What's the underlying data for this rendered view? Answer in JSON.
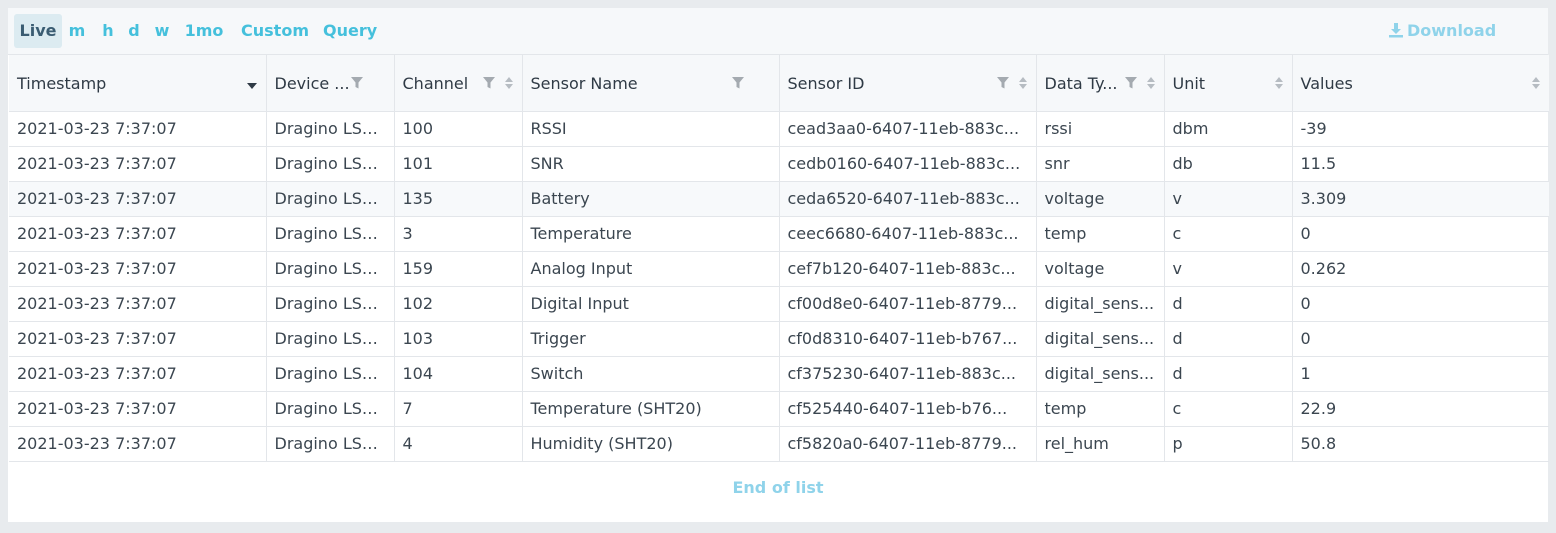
{
  "toolbar": {
    "ranges": [
      "Live",
      "m",
      "h",
      "d",
      "w",
      "1mo",
      "Custom",
      "Query"
    ],
    "active_range": "Live",
    "download_label": "Download"
  },
  "colors": {
    "accent": "#45c0dc",
    "muted_accent": "#8fd3ea",
    "active_bg": "#dcebf1"
  },
  "table": {
    "columns": [
      "Timestamp",
      "Device ...",
      "Channel",
      "Sensor Name",
      "Sensor ID",
      "Data Ty...",
      "Unit",
      "Values"
    ],
    "rows": [
      [
        "2021-03-23 7:37:07",
        "Dragino LSN...",
        "100",
        "RSSI",
        "cead3aa0-6407-11eb-883c...",
        "rssi",
        "dbm",
        "-39"
      ],
      [
        "2021-03-23 7:37:07",
        "Dragino LSN...",
        "101",
        "SNR",
        "cedb0160-6407-11eb-883c...",
        "snr",
        "db",
        "11.5"
      ],
      [
        "2021-03-23 7:37:07",
        "Dragino LSN...",
        "135",
        "Battery",
        "ceda6520-6407-11eb-883c...",
        "voltage",
        "v",
        "3.309"
      ],
      [
        "2021-03-23 7:37:07",
        "Dragino LSN...",
        "3",
        "Temperature",
        "ceec6680-6407-11eb-883c...",
        "temp",
        "c",
        "0"
      ],
      [
        "2021-03-23 7:37:07",
        "Dragino LSN...",
        "159",
        "Analog Input",
        "cef7b120-6407-11eb-883c...",
        "voltage",
        "v",
        "0.262"
      ],
      [
        "2021-03-23 7:37:07",
        "Dragino LSN...",
        "102",
        "Digital Input",
        "cf00d8e0-6407-11eb-8779...",
        "digital_sens...",
        "d",
        "0"
      ],
      [
        "2021-03-23 7:37:07",
        "Dragino LSN...",
        "103",
        "Trigger",
        "cf0d8310-6407-11eb-b767...",
        "digital_sens...",
        "d",
        "0"
      ],
      [
        "2021-03-23 7:37:07",
        "Dragino LSN...",
        "104",
        "Switch",
        "cf375230-6407-11eb-883c...",
        "digital_sens...",
        "d",
        "1"
      ],
      [
        "2021-03-23 7:37:07",
        "Dragino LSN...",
        "7",
        "Temperature (SHT20)",
        "cf525440-6407-11eb-b76...",
        "temp",
        "c",
        "22.9"
      ],
      [
        "2021-03-23 7:37:07",
        "Dragino LSN...",
        "4",
        "Humidity (SHT20)",
        "cf5820a0-6407-11eb-8779...",
        "rel_hum",
        "p",
        "50.8"
      ]
    ]
  },
  "footer": {
    "end_label": "End of list"
  }
}
